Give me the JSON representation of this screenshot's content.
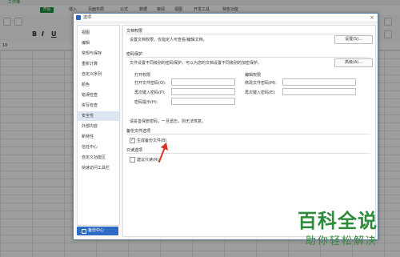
{
  "app": {
    "title": "工作簿",
    "menu": [
      "开始",
      "插入",
      "页面布局",
      "公式",
      "数据",
      "审阅",
      "视图",
      "开发工具",
      "特色功能"
    ],
    "name_box": "10",
    "ribbon_glyphs": [
      "B",
      "I",
      "U"
    ]
  },
  "dialog": {
    "title": "选项",
    "close": "×",
    "nav": [
      "视图",
      "编辑",
      "常规与保存",
      "重新计算",
      "自定义序列",
      "颜色",
      "错误检查",
      "拼写检查",
      "安全性",
      "外部内容",
      "新特性",
      "信任中心",
      "自定义功能区",
      "快速访问工具栏"
    ],
    "active_nav": "安全性",
    "backup_center": "备份中心",
    "doc_permission": {
      "title": "文档权限",
      "desc": "设置文档权限，仅指定人可查看/编辑文档。",
      "button": "设置(S)..."
    },
    "password": {
      "title": "密码保护",
      "desc": "文件设置不同级别的密码保护，可以为您的文档设置不同级别的加密保护。",
      "button": "高级(A)...",
      "open_title": "打开权限",
      "edit_title": "编辑权限",
      "open_pwd": "打开文件密码(O):",
      "open_pwd2": "再次键入密码(P):",
      "hint": "密码提示(H):",
      "edit_pwd": "修改文件密码(M):",
      "edit_pwd2": "再次键入密码(E):",
      "note": "请妥善保管密码，一旦遗忘，则无法恢复。"
    },
    "backup": {
      "title": "备份文件选项",
      "checkbox": "生成备份文件(B)",
      "checked": true
    },
    "readonly": {
      "title": "只读选项",
      "checkbox": "建议只读(R)",
      "checked": false
    }
  },
  "watermark": {
    "main": "百科全说",
    "sub": "助你轻松解决"
  },
  "colors": {
    "accent": "#2f6bc6",
    "arrow": "#d9342b",
    "brand_green": "#2e8b3a"
  }
}
